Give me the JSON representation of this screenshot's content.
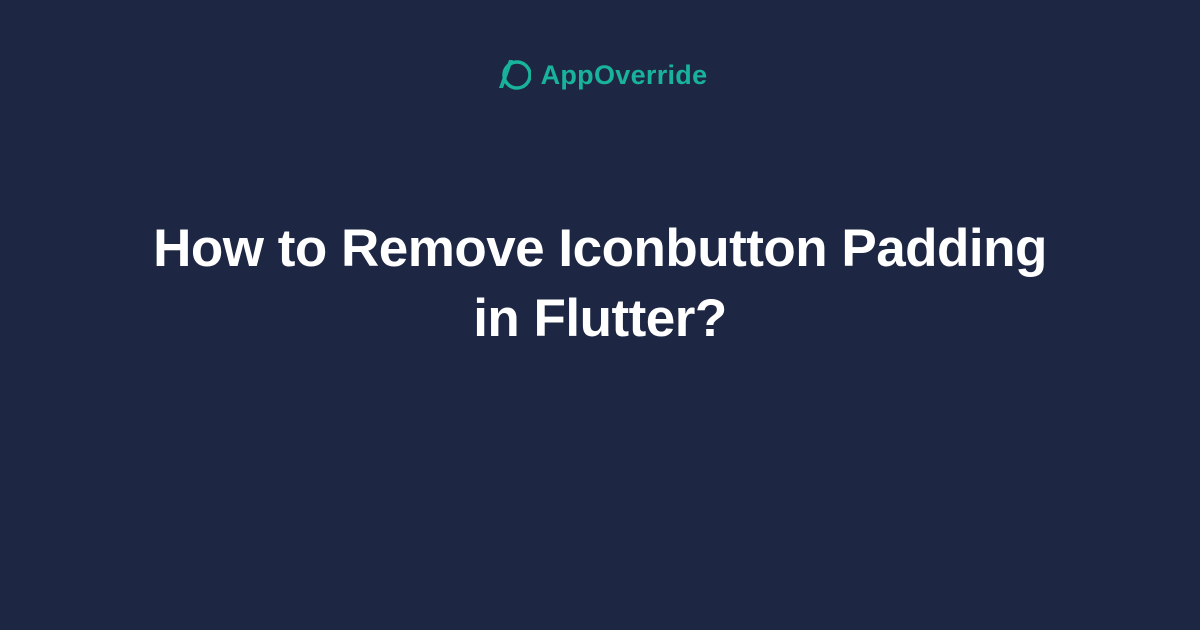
{
  "brand": {
    "name": "AppOverride",
    "accent_color": "#18b39a"
  },
  "page": {
    "title": "How to Remove Iconbutton Padding in Flutter?",
    "background_color": "#1d2743",
    "text_color": "#ffffff"
  }
}
